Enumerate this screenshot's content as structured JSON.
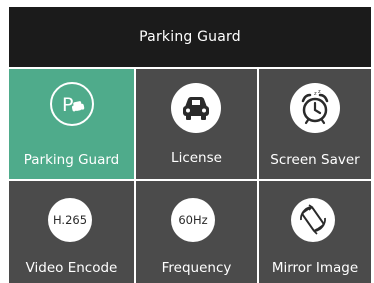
{
  "header": {
    "title": "Parking Guard"
  },
  "tiles": [
    {
      "label": "Parking Guard",
      "icon": "parking-car-icon",
      "active": true
    },
    {
      "label": "License",
      "icon": "car-icon"
    },
    {
      "label": "Screen Saver",
      "icon": "alarm-clock-icon"
    },
    {
      "label": "Video Encode",
      "icon": "codec-badge-icon",
      "badge": "H.265"
    },
    {
      "label": "Frequency",
      "icon": "frequency-badge-icon",
      "badge": "60Hz"
    },
    {
      "label": "Mirror Image",
      "icon": "mirror-rotate-icon"
    }
  ],
  "colors": {
    "header_bg": "#1b1b1b",
    "tile_bg": "#4b4b4b",
    "active_bg": "#4fab8b",
    "text": "#ffffff"
  }
}
